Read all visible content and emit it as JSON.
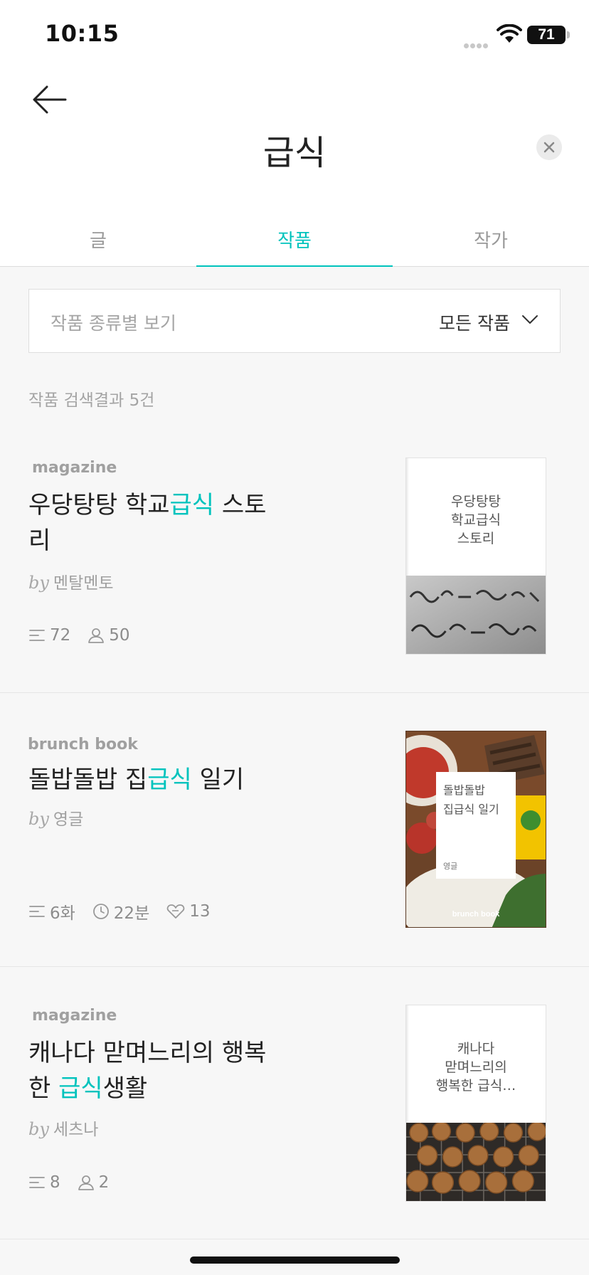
{
  "status_bar": {
    "time": "10:15",
    "battery": "71"
  },
  "header": {
    "title": "급식"
  },
  "tabs": [
    {
      "label": "글",
      "active": false
    },
    {
      "label": "작품",
      "active": true
    },
    {
      "label": "작가",
      "active": false
    }
  ],
  "filter": {
    "label": "작품 종류별 보기",
    "value": "모든 작품"
  },
  "result_count": "작품 검색결과 5건",
  "items": [
    {
      "type": "magazine",
      "title_before": "우당탕탕 학교",
      "title_highlight": "급식",
      "title_after": " 스토리",
      "by": "by",
      "author": "멘탈멘토",
      "stat1": "72",
      "stat2": "50",
      "cover_text": "우당탕탕\n학교급식\n스토리"
    },
    {
      "type": "brunch book",
      "title_before": "돌밥돌밥 집",
      "title_highlight": "급식",
      "title_after": " 일기",
      "by": "by",
      "author": "영글",
      "stat1": "6화",
      "stat2": "22분",
      "stat3": "13",
      "cover_title": "돌밥돌밥\n집급식 일기",
      "cover_author": "영글",
      "cover_brand": "brunch book"
    },
    {
      "type": "magazine",
      "title_before": "캐나다 맏며느리의 행복한 ",
      "title_highlight": "급식",
      "title_after": "생활",
      "by": "by",
      "author": "세츠나",
      "stat1": "8",
      "stat2": "2",
      "cover_text": "캐나다\n맏며느리의\n행복한 급식…"
    }
  ],
  "colors": {
    "accent": "#00c3bd",
    "background": "#f7f7f7"
  }
}
